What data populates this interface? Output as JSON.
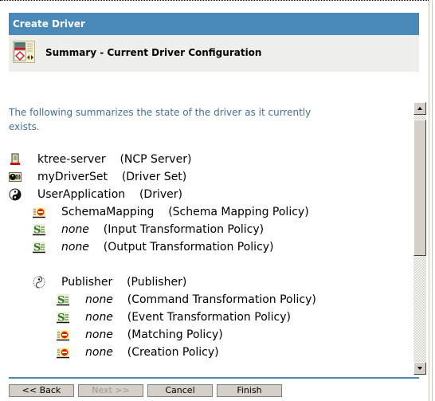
{
  "window": {
    "title": "Create Driver"
  },
  "header": {
    "icon": "summary-config-icon",
    "title": "Summary - Current Driver Configuration"
  },
  "intro_text": "The following summarizes the state of the driver as it currently exists.",
  "tree": [
    {
      "icon": "ncp-server-icon",
      "name": "ktree-server",
      "name_italic": false,
      "type": "(NCP Server)",
      "level": 0
    },
    {
      "icon": "driver-set-icon",
      "name": "myDriverSet",
      "name_italic": false,
      "type": "(Driver Set)",
      "level": 0
    },
    {
      "icon": "driver-icon",
      "name": "UserApplication",
      "name_italic": false,
      "type": "(Driver)",
      "level": 0
    },
    {
      "icon": "rule-policy-icon",
      "name": "SchemaMapping",
      "name_italic": false,
      "type": "(Schema Mapping Policy)",
      "level": 1
    },
    {
      "icon": "stylesheet-policy-icon",
      "name": "none",
      "name_italic": true,
      "type": "(Input Transformation Policy)",
      "level": 1
    },
    {
      "icon": "stylesheet-policy-icon",
      "name": "none",
      "name_italic": true,
      "type": "(Output Transformation Policy)",
      "level": 1
    },
    {
      "icon": "publisher-icon",
      "name": "Publisher",
      "name_italic": false,
      "type": "(Publisher)",
      "level": 1
    },
    {
      "icon": "stylesheet-policy-icon",
      "name": "none",
      "name_italic": true,
      "type": "(Command Transformation Policy)",
      "level": 2
    },
    {
      "icon": "stylesheet-policy-icon",
      "name": "none",
      "name_italic": true,
      "type": "(Event Transformation Policy)",
      "level": 2
    },
    {
      "icon": "rule-policy-icon",
      "name": "none",
      "name_italic": true,
      "type": "(Matching Policy)",
      "level": 2
    },
    {
      "icon": "rule-policy-icon",
      "name": "none",
      "name_italic": true,
      "type": "(Creation Policy)",
      "level": 2
    }
  ],
  "scrollbar": {
    "position_fraction": 0.0,
    "visible_fraction": 0.55
  },
  "buttons": {
    "back": "<< Back",
    "next": "Next >>",
    "cancel": "Cancel",
    "finish": "Finish"
  },
  "colors": {
    "title_bar": "#4a8ab9",
    "header_bg": "#eeeeea",
    "intro_text": "#436f8f"
  }
}
